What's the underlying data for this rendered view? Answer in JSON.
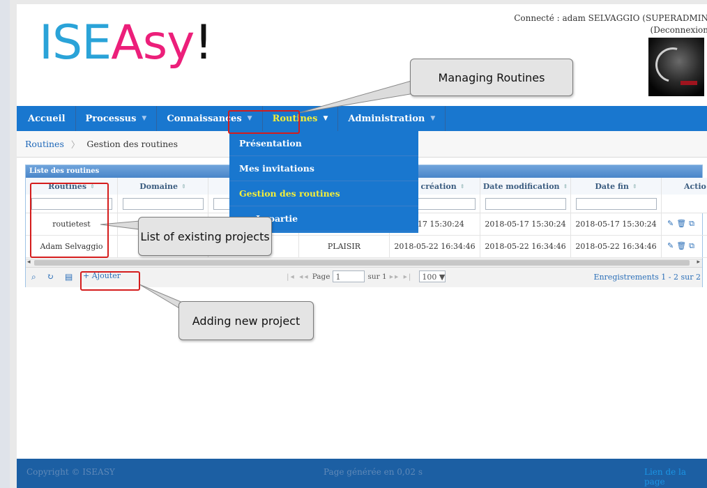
{
  "header": {
    "logo": {
      "part1": "ISE",
      "part2": "Asy",
      "part3": "!"
    },
    "connected_text": "Connecté : adam SELVAGGIO (SUPERADMIN",
    "logout_text": "(Deconnexion"
  },
  "nav": {
    "items": [
      {
        "label": "Accueil",
        "caret": ""
      },
      {
        "label": "Processus",
        "caret": "▼"
      },
      {
        "label": "Connaissances",
        "caret": "▼"
      },
      {
        "label": "Routines",
        "caret": "▼",
        "active": true
      },
      {
        "label": "Administration",
        "caret": "▼"
      }
    ],
    "dropdown": [
      "Présentation",
      "Mes invitations",
      "Gestion des routines",
      "Je partie"
    ]
  },
  "breadcrumb": {
    "link": "Routines",
    "separator": "〉",
    "current": "Gestion des routines"
  },
  "grid": {
    "title": "Liste des routines",
    "columns": [
      "Routines",
      "Domaine",
      "",
      "",
      "ate création",
      "Date modification",
      "Date fin",
      "Actio"
    ],
    "sort_icon": "⇕",
    "rows": [
      {
        "routine": "routietest",
        "domaine": "",
        "c3": "",
        "c4": "",
        "created": "05-17 15:30:24",
        "modified": "2018-05-17 15:30:24",
        "end": "2018-05-17 15:30:24",
        "actions": "✎🗑⧉"
      },
      {
        "routine": "Adam Selvaggio",
        "domaine": "",
        "c3": "",
        "c4": "PLAISIR",
        "created": "2018-05-22 16:34:46",
        "modified": "2018-05-22 16:34:46",
        "end": "2018-05-22 16:34:46",
        "actions": "✎🗑⧉"
      }
    ],
    "pager": {
      "icons": [
        "⌕",
        "↻",
        "▤"
      ],
      "add_label": "+ Ajouter",
      "first_prev": "|◂ ◂◂",
      "page_label": "Page",
      "page_value": "1",
      "of_label": "sur 1",
      "next_last": "▸▸ ▸|",
      "rows_per_page": "100 ▼",
      "records": "Enregistrements 1 - 2 sur 2"
    }
  },
  "callouts": {
    "routines": "Managing Routines",
    "list": "List of existing projects",
    "add": "Adding new project"
  },
  "footer": {
    "copyright": "Copyright © ISEASY",
    "generated": "Page générée en 0,02 s",
    "right": "Lien de la page"
  },
  "colors": {
    "nav_blue": "#1977cf",
    "active_yellow": "#f3ee3a",
    "logo_blue": "#2aa3d8",
    "logo_pink": "#ec1f7a",
    "highlight_red": "#d41c1c",
    "footer_blue": "#1c5fa3"
  }
}
